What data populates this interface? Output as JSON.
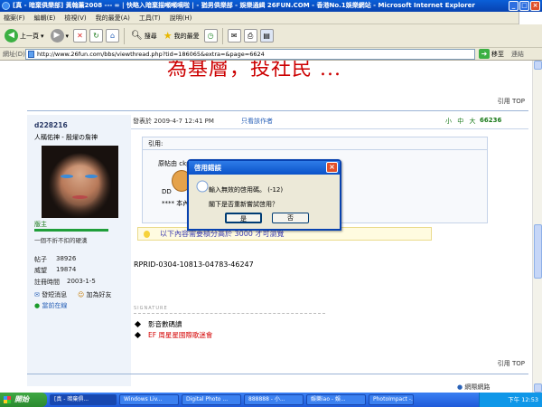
{
  "window": {
    "title": "[真 - 暗棄俱樂部] 黃翰薰2008 --- ∞ | 快略入暗棄描噸噸嘀啦 | - 猶男俱樂部 - 娛樂通緝 26FUN.COM - 香港No.1娛樂網站 - Microsoft Internet Explorer"
  },
  "menu": [
    "檔案(F)",
    "編輯(E)",
    "檢視(V)",
    "我的最愛(A)",
    "工具(T)",
    "說明(H)"
  ],
  "toolbar": {
    "back": "上一頁",
    "search": "搜尋",
    "favorites": "我的最愛"
  },
  "address": {
    "label": "網址(D)",
    "url": "http://www.26fun.com/bbs/viewthread.php?tid=186065&extra=&page=6624",
    "go": "移至",
    "links": "連結"
  },
  "page": {
    "big_heading": "為基層，投社民 ...",
    "reply_top_1": "引用 TOP",
    "reply_top_2": "引用 TOP",
    "post": {
      "username": "d228216",
      "user_title": "人稱佑神 - 殷燿の詹神",
      "rank": "版主",
      "rank_desc": "一個不折不扣的硬漢",
      "stats": [
        {
          "label": "帖子",
          "value": "38926"
        },
        {
          "label": "威望",
          "value": "19874"
        },
        {
          "label": "註冊時間",
          "value": "2003-1-5"
        }
      ],
      "send_msg": "發短消息",
      "add_friend": "加為好友",
      "online": "當前在線",
      "posted_at": "發表於 2009-4-7 12:41 PM",
      "author_only": "只看該作者",
      "font_sizes": "小 中 大",
      "post_id": "66236",
      "quote_label": "引用:",
      "quote_orig": "原帖由 ckp1",
      "quote_dd": "DD",
      "quote_hidden": "**** 本內容被",
      "notice": "以下內容需要積分高於 3000 才可瀏覽",
      "rprid": "RPRID-0304-10813-04783-46247",
      "sig_label": "SIGNATURE",
      "sig_items": [
        {
          "text": "影音數碼讀",
          "color": "#000000"
        },
        {
          "text": "EF 周星星國際歌迷會",
          "color": "#d40000"
        }
      ]
    }
  },
  "dialog": {
    "title": "啓用錯誤",
    "line1": "輸入無效的啓用碼。 (-12)",
    "line2": "閣下是否重新嘗試啓用？",
    "yes": "是",
    "no": "否"
  },
  "taskbar": {
    "start": "開始",
    "tasks": [
      "[真 - 暗棄俱...",
      "Windows Liv...",
      "Digital Photo ...",
      "888888 - 小...",
      "娛樂iao - 娛...",
      "PhotoImpact -..."
    ],
    "network": "網際網路",
    "time": "下午 12:53"
  }
}
